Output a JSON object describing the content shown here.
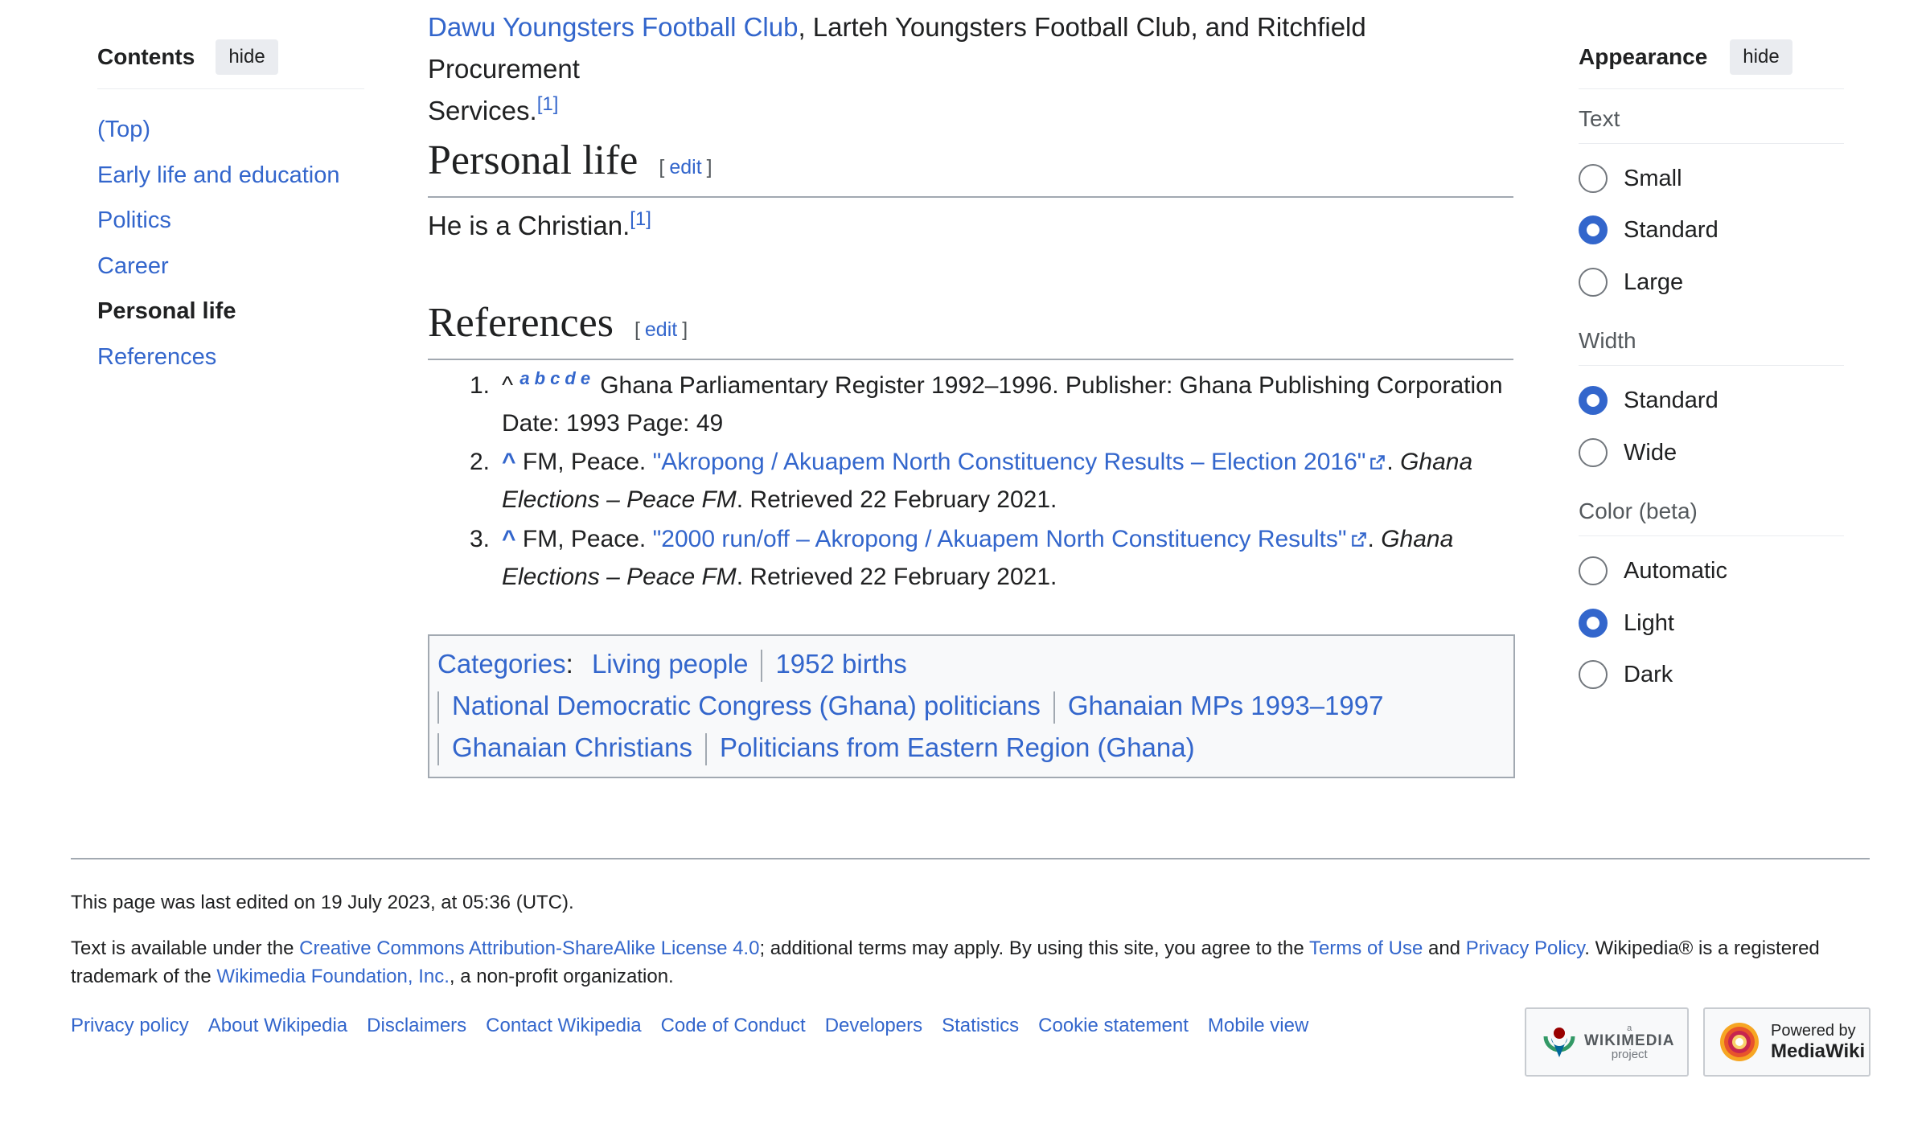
{
  "toc": {
    "title": "Contents",
    "hide_label": "hide",
    "items": [
      {
        "label": "(Top)",
        "active": false
      },
      {
        "label": "Early life and education",
        "active": false
      },
      {
        "label": "Politics",
        "active": false
      },
      {
        "label": "Career",
        "active": false
      },
      {
        "label": "Personal life",
        "active": true
      },
      {
        "label": "References",
        "active": false
      }
    ]
  },
  "intro": {
    "link1": "Dawu Youngsters Football Club",
    "text1": ", Larteh Youngsters Football Club, and Ritchfield Procurement",
    "text2": "Services.",
    "cite": "[1]"
  },
  "personal_life": {
    "heading": "Personal life",
    "edit_open": "[",
    "edit_label": "edit",
    "edit_close": "]",
    "text": "He is a Christian.",
    "cite": "[1]"
  },
  "references": {
    "heading": "References",
    "edit_open": "[",
    "edit_label": "edit",
    "edit_close": "]",
    "items": [
      {
        "num": "1.",
        "caret": "^",
        "backlinks": [
          "a",
          "b",
          "c",
          "d",
          "e"
        ],
        "line1": "Ghana Parliamentary Register 1992–1996. Publisher: Ghana Publishing Corporation",
        "line2": "Date: 1993 Page: 49"
      },
      {
        "num": "2.",
        "caret": "^",
        "prefix": "FM, Peace.",
        "link": "\"Akropong / Akuapem North Constituency Results – Election 2016\"",
        "after_link": ".",
        "pub_part1": "Ghana",
        "pub_part2": "Elections – Peace FM",
        "retrieved": ". Retrieved 22 February 2021."
      },
      {
        "num": "3.",
        "caret": "^",
        "prefix": "FM, Peace.",
        "link": "\"2000 run/off – Akropong / Akuapem North Constituency Results\"",
        "after_link": ".",
        "pub_part1": "Ghana",
        "pub_part2": "Elections – Peace FM",
        "retrieved": ". Retrieved 22 February 2021."
      }
    ]
  },
  "categories": {
    "label": "Categories",
    "colon": ":",
    "row1": [
      "Living people",
      "1952 births"
    ],
    "row2": [
      "National Democratic Congress (Ghana) politicians",
      "Ghanaian MPs 1993–1997"
    ],
    "row3": [
      "Ghanaian Christians",
      "Politicians from Eastern Region (Ghana)"
    ]
  },
  "appearance": {
    "title": "Appearance",
    "hide_label": "hide",
    "text_group": {
      "label": "Text",
      "options": [
        {
          "label": "Small",
          "checked": false
        },
        {
          "label": "Standard",
          "checked": true
        },
        {
          "label": "Large",
          "checked": false
        }
      ]
    },
    "width_group": {
      "label": "Width",
      "options": [
        {
          "label": "Standard",
          "checked": true
        },
        {
          "label": "Wide",
          "checked": false
        }
      ]
    },
    "color_group": {
      "label": "Color (beta)",
      "options": [
        {
          "label": "Automatic",
          "checked": false
        },
        {
          "label": "Light",
          "checked": true
        },
        {
          "label": "Dark",
          "checked": false
        }
      ]
    }
  },
  "footer": {
    "last_edited": "This page was last edited on 19 July 2023, at 05:36 (UTC).",
    "license_pre": "Text is available under the ",
    "license_link": "Creative Commons Attribution-ShareAlike License 4.0",
    "license_mid": "; additional terms may apply. By using this site, you agree to the ",
    "terms_link": "Terms of Use",
    "and": " and ",
    "privacy_link": "Privacy Policy",
    "trademark": ". Wikipedia® is a registered",
    "line2_pre": "trademark of the ",
    "foundation_link": "Wikimedia Foundation, Inc.",
    "line2_post": ", a non-profit organization.",
    "links": [
      "Privacy policy",
      "About Wikipedia",
      "Disclaimers",
      "Contact Wikipedia",
      "Code of Conduct",
      "Developers",
      "Statistics",
      "Cookie statement",
      "Mobile view"
    ],
    "wikimedia_badge": {
      "small": "a",
      "name": "WIKIMEDIA",
      "sub": "project"
    },
    "mediawiki_badge": {
      "line1": "Powered by",
      "line2": "MediaWiki"
    }
  }
}
